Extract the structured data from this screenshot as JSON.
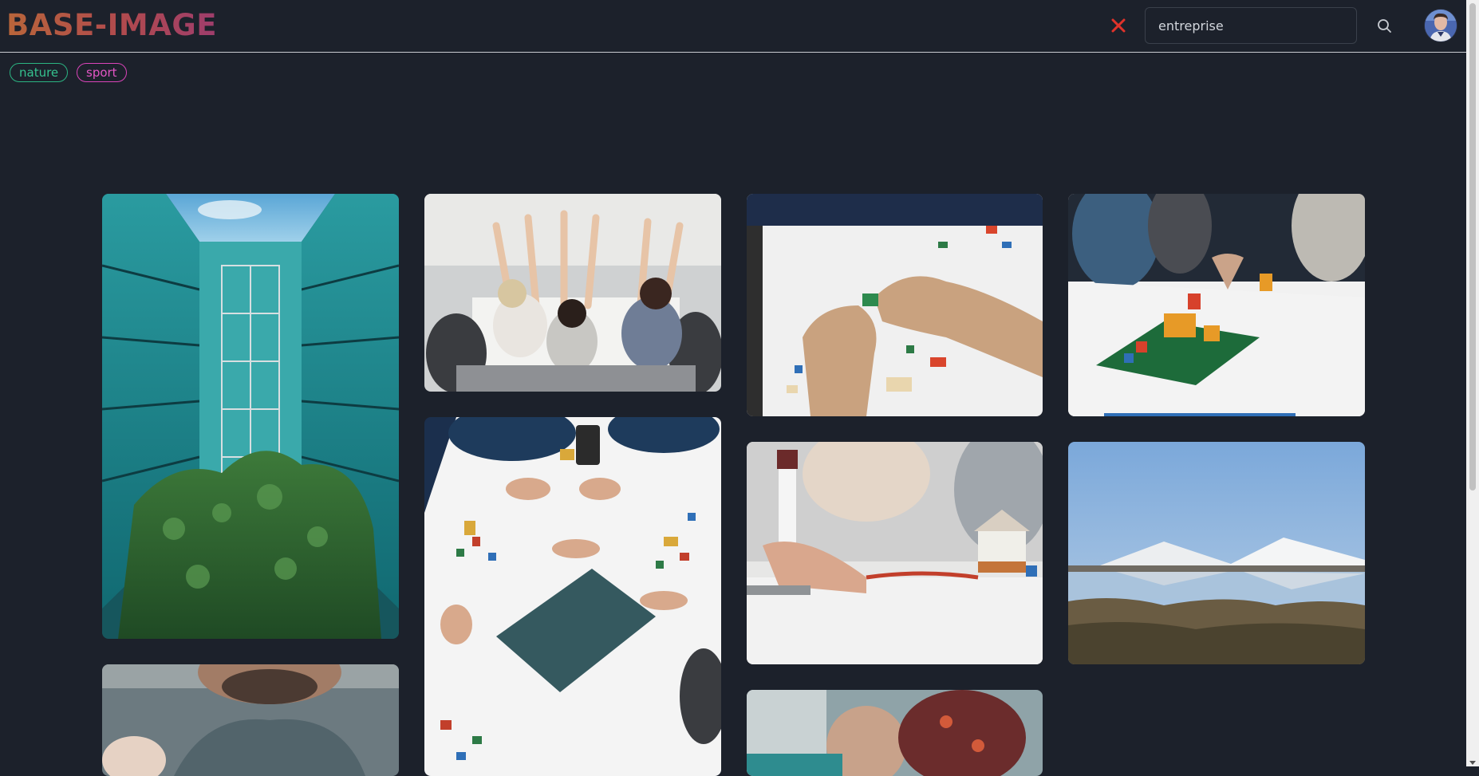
{
  "header": {
    "logo": "BASE-IMAGE",
    "search": {
      "value": "entreprise",
      "placeholder": ""
    },
    "clear_icon": "close-icon",
    "search_icon": "search-icon"
  },
  "tags": [
    {
      "label": "nature",
      "color": "#2bb482"
    },
    {
      "label": "sport",
      "color": "#d944b9"
    }
  ],
  "gallery": {
    "images": [
      {
        "alt": "Modern teal glass office building courtyard with plants"
      },
      {
        "alt": "Team celebrating with raised arms at a meeting table"
      },
      {
        "alt": "Hands building with colorful bricks on a white table"
      },
      {
        "alt": "Brick model on a green baseplate being pointed at"
      },
      {
        "alt": "Team hands around a table with brick models, top view"
      },
      {
        "alt": "Hands assembling a brick model with a small house"
      },
      {
        "alt": "Salt mountains reflected in water with marsh vegetation"
      },
      {
        "alt": "Bearded man in grey sweater looking down"
      },
      {
        "alt": "Blurred people around a table"
      }
    ]
  },
  "colors": {
    "background": "#1c212b",
    "accent_close": "#e0332b",
    "tag_nature": "#2bb482",
    "tag_sport": "#d944b9"
  }
}
